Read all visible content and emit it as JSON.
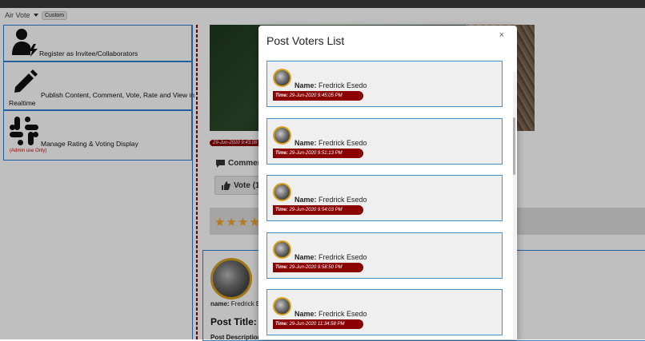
{
  "nav": {
    "dropdown_label": "Air Vote",
    "badge": "Custom"
  },
  "sidebar": {
    "items": [
      {
        "label": "Register as Invitee/Collaborators",
        "icon": "user-bolt-icon"
      },
      {
        "label": "Publish Content, Comment, Vote, Rate and View in",
        "sub": "Realtime",
        "icon": "pencil-icon"
      },
      {
        "label": "Manage Rating & Voting Display",
        "note": "(Admin use Only)",
        "icon": "slack-icon"
      }
    ]
  },
  "post": {
    "timestamp": "29-Jun-2020 9:43:06 P",
    "comment_label": "Commen",
    "vote_label": "Vote (1",
    "card_name_label": "name:",
    "card_name_value": "Fredrick Es",
    "post_title": "Post Title:",
    "post_description": "Post Description"
  },
  "modal": {
    "title": "Post Voters List",
    "close": "×",
    "name_label": "Name:",
    "time_label": "Time:",
    "voters": [
      {
        "name": "Fredrick Esedo",
        "time": "29-Jun-2020 9:45:05 PM"
      },
      {
        "name": "Fredrick Esedo",
        "time": "29-Jun-2020 9:51:13 PM"
      },
      {
        "name": "Fredrick Esedo",
        "time": "29-Jun-2020 9:54:03 PM"
      },
      {
        "name": "Fredrick Esedo",
        "time": "29-Jun-2020 9:58:50 PM"
      },
      {
        "name": "Fredrick Esedo",
        "time": "29-Jun-2020 11:34:58 PM"
      }
    ]
  },
  "colors": {
    "accent_blue": "#2f7fd0",
    "time_badge": "#8b0000",
    "avatar_ring": "#d9a21b",
    "star": "#f5a623"
  }
}
